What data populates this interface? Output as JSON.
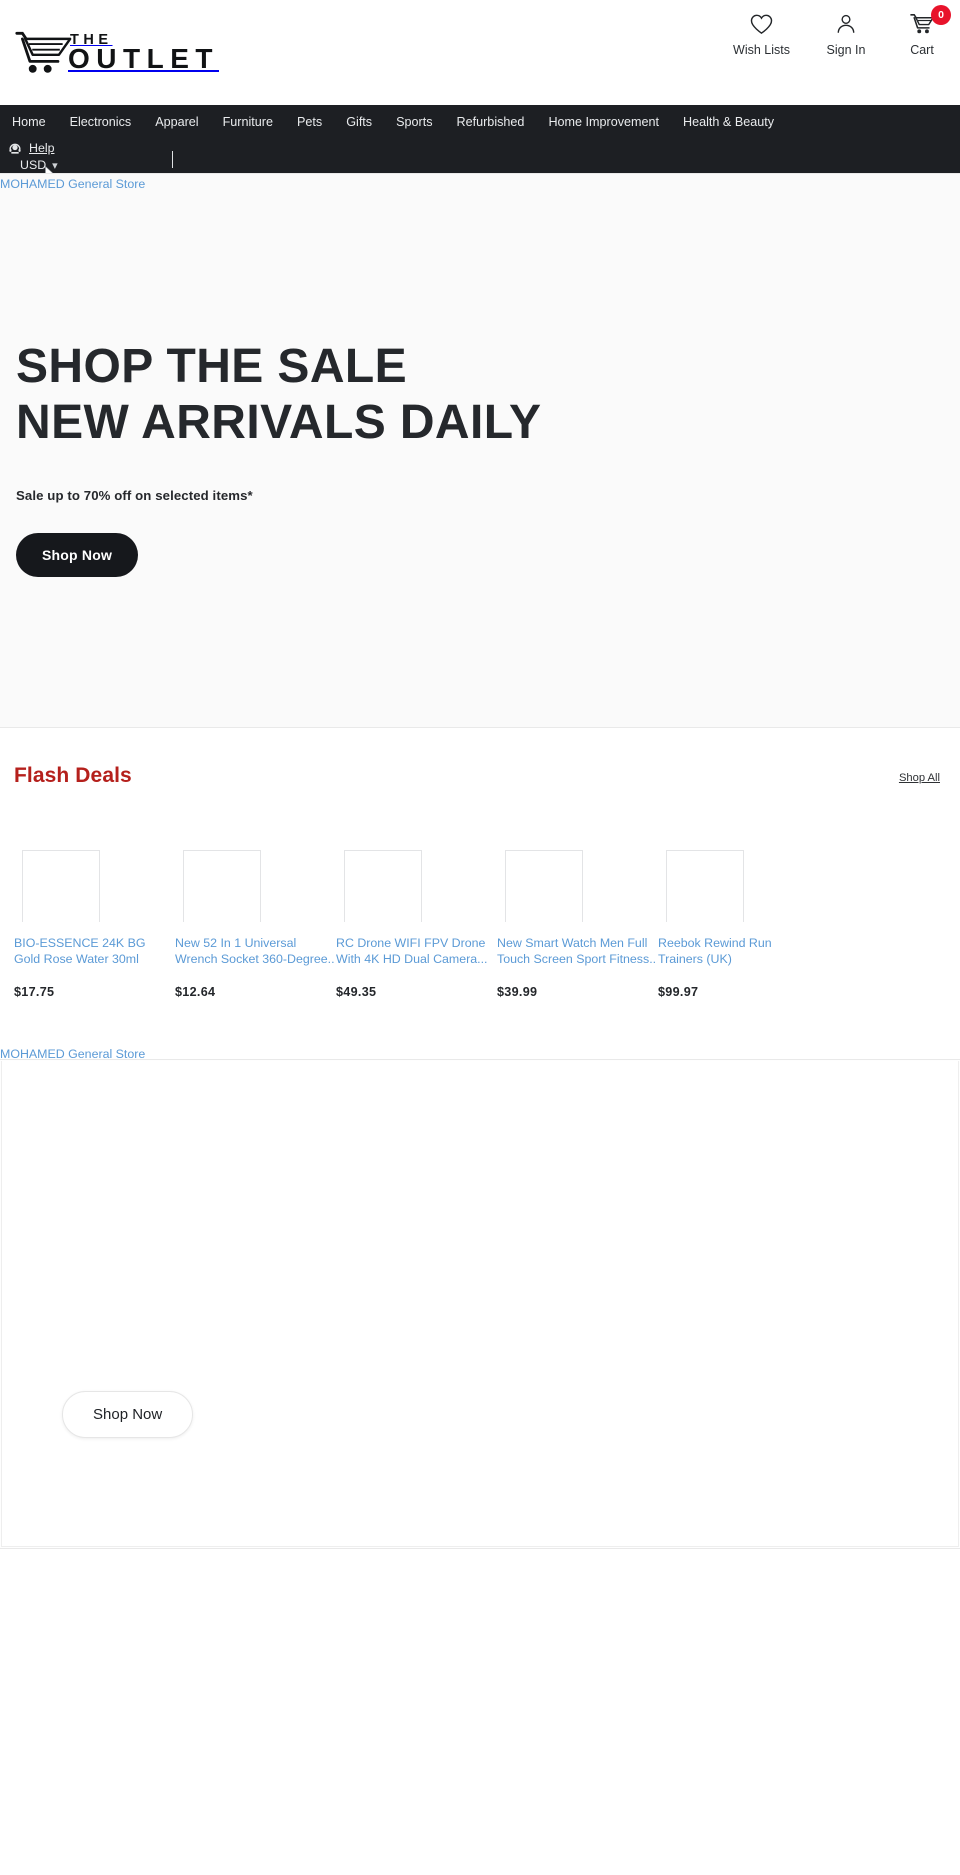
{
  "brand": {
    "logo_top": "THE",
    "logo_bottom": "OUTLET",
    "logo_icon": "shopping-cart-icon"
  },
  "header": {
    "actions": [
      {
        "label": "Wish Lists",
        "icon": "heart-icon"
      },
      {
        "label": "Sign In",
        "icon": "user-icon"
      },
      {
        "label": "Cart",
        "icon": "cart-icon",
        "badge": "0"
      }
    ],
    "cart_badge_color": "#e8132b"
  },
  "nav": {
    "background": "#1d1f23",
    "items": [
      "Home",
      "Electronics",
      "Apparel",
      "Furniture",
      "Pets",
      "Gifts",
      "Sports",
      "Refurbished",
      "Home Improvement",
      "Health & Beauty"
    ],
    "help_label": "Help",
    "help_icon": "support-headset-icon",
    "currency_label": "USD",
    "currency_caret": "▾"
  },
  "hero": {
    "broken_image_alt": "MOHAMED General Store",
    "title_line1": "SHOP THE SALE",
    "title_line2": "NEW ARRIVALS DAILY",
    "subtitle": "Sale up to 70% off on selected items*",
    "cta_label": "Shop Now"
  },
  "flash_deals": {
    "title": "Flash Deals",
    "title_color": "#b5201c",
    "shop_all_label": "Shop All",
    "products": [
      {
        "name": "BIO-ESSENCE 24K BG Gold Rose Water 30ml",
        "price": "$17.75"
      },
      {
        "name": "New 52 In 1 Universal Wrench Socket 360-Degree..",
        "price": "$12.64"
      },
      {
        "name": "RC Drone WIFI FPV Drone With 4K HD Dual Camera...",
        "price": "$49.35"
      },
      {
        "name": "New Smart Watch Men Full Touch Screen Sport Fitness..",
        "price": "$39.99"
      },
      {
        "name": "Reebok Rewind Run Trainers (UK)",
        "price": "$99.97"
      }
    ]
  },
  "promo": {
    "broken_image_alt": "MOHAMED General Store",
    "cta_label": "Shop Now"
  }
}
